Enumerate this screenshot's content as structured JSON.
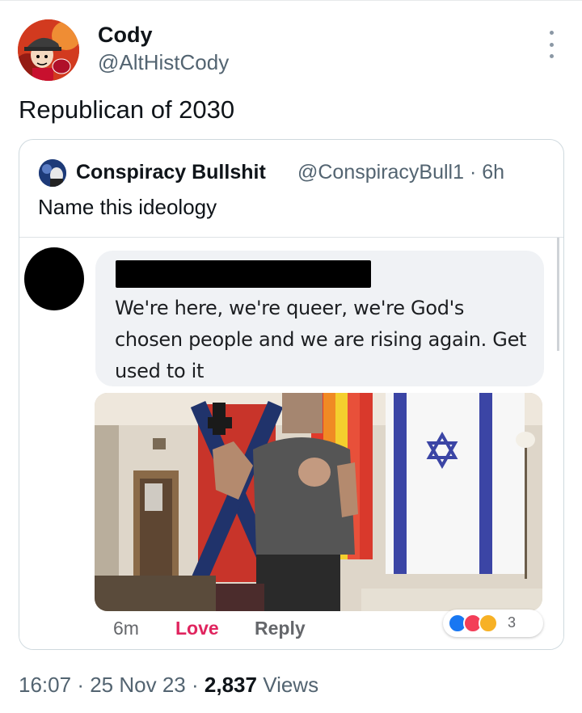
{
  "author": {
    "name": "Cody",
    "handle": "@AltHistCody"
  },
  "tweet": {
    "text": "Republican of 2030"
  },
  "quoted": {
    "name": "Conspiracy Bullshit",
    "handle": "@ConspiracyBull1",
    "separator": "·",
    "age": "6h",
    "text": "Name this ideology",
    "facebook_comment": {
      "text": "We're here, we're queer, we're God's chosen people and we are rising again.  Get used to it",
      "time": "6m",
      "love_label": "Love",
      "reply_label": "Reply",
      "reaction_count": "3"
    }
  },
  "footer": {
    "time": "16:07",
    "date": "25 Nov 23",
    "views_count": "2,837",
    "views_label": "Views",
    "separator": "·"
  },
  "colors": {
    "secondary_text": "#536471",
    "love_red": "#e0245e",
    "fb_blue": "#1877f2"
  },
  "icons": [
    "more-options-icon",
    "like-reaction-icon",
    "love-reaction-icon",
    "haha-reaction-icon"
  ]
}
